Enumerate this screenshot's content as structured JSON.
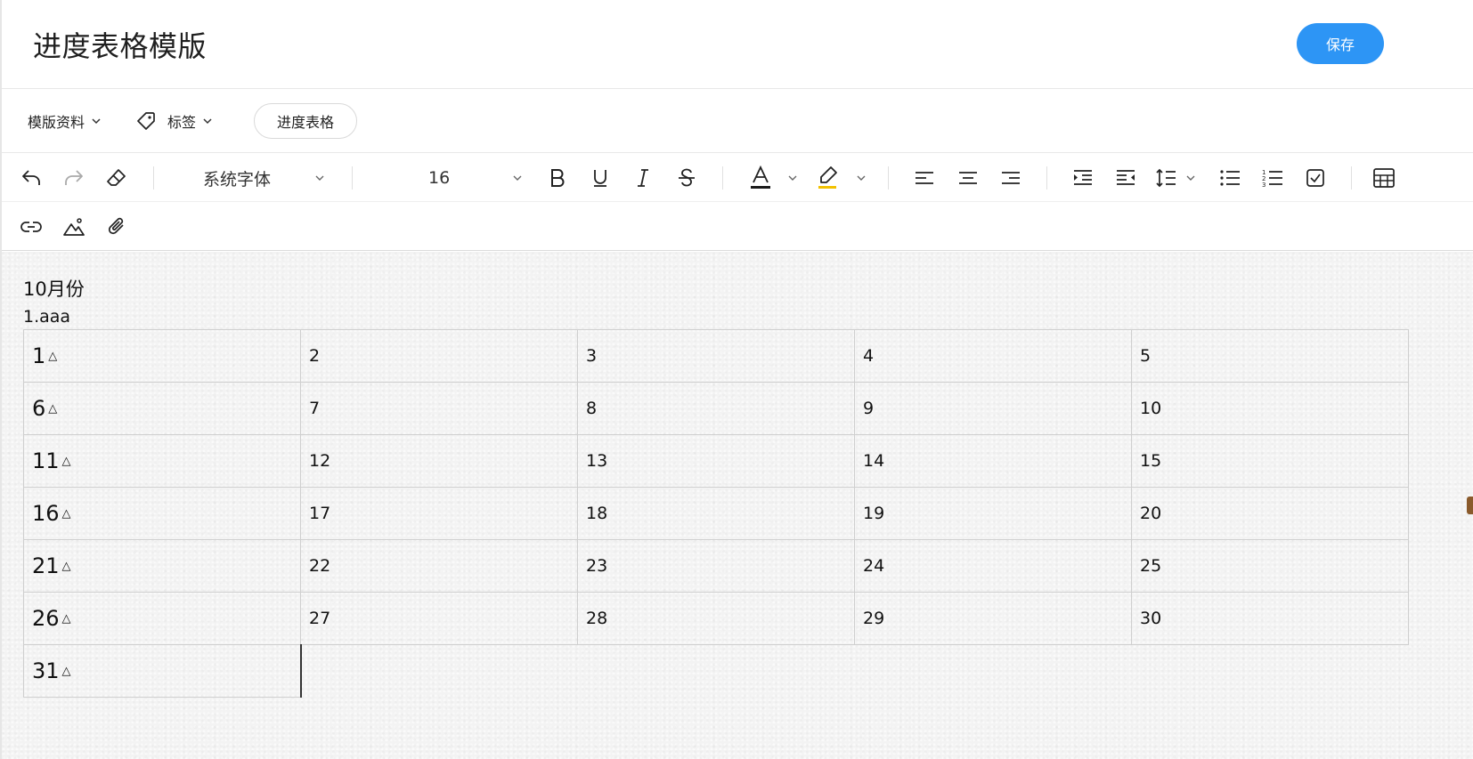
{
  "header": {
    "title": "进度表格模版",
    "save_label": "保存"
  },
  "meta": {
    "template_info_label": "模版资料",
    "tags_label": "标签",
    "tag_pill": "进度表格"
  },
  "toolbar": {
    "font_family": "系统字体",
    "font_size": "16",
    "colors": {
      "text_color_underline": "#1a1a1a",
      "highlight_underline": "#f2c100",
      "accent": "#2d95f5"
    },
    "icons_row1": [
      "undo-icon",
      "redo-icon",
      "eraser-icon",
      "bold-icon",
      "underline-icon",
      "italic-icon",
      "strikethrough-icon",
      "font-color-icon",
      "highlight-icon",
      "align-left-icon",
      "align-center-icon",
      "align-right-icon",
      "indent-increase-icon",
      "indent-decrease-icon",
      "line-height-icon",
      "bullet-list-icon",
      "numbered-list-icon",
      "checklist-icon",
      "table-icon"
    ],
    "icons_row2": [
      "link-icon",
      "image-icon",
      "attachment-icon"
    ]
  },
  "document": {
    "heading": "10月份",
    "subline": "1.aaa",
    "table_rows": [
      [
        "1",
        "2",
        "3",
        "4",
        "5"
      ],
      [
        "6",
        "7",
        "8",
        "9",
        "10"
      ],
      [
        "11",
        "12",
        "13",
        "14",
        "15"
      ],
      [
        "16",
        "17",
        "18",
        "19",
        "20"
      ],
      [
        "21",
        "22",
        "23",
        "24",
        "25"
      ],
      [
        "26",
        "27",
        "28",
        "29",
        "30"
      ],
      [
        "31"
      ]
    ],
    "first_col_marker": "△"
  }
}
